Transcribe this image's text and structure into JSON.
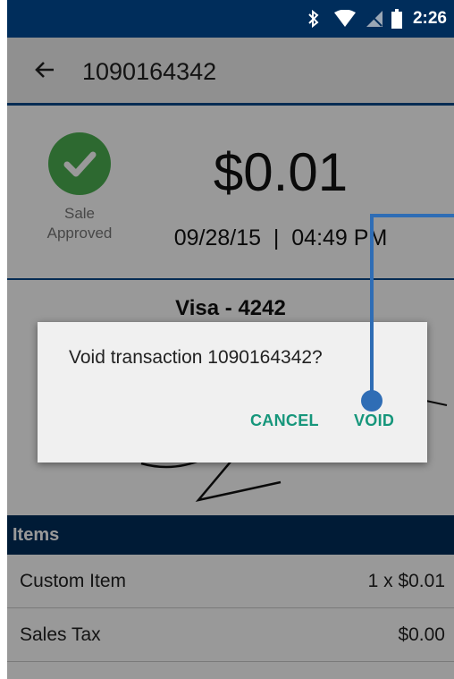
{
  "status_bar": {
    "time": "2:26",
    "icons": [
      "bluetooth-icon",
      "wifi-icon",
      "no-signal-icon",
      "battery-icon"
    ]
  },
  "app_bar": {
    "title": "1090164342",
    "back_icon": "arrow-left-icon"
  },
  "transaction": {
    "status_line1": "Sale",
    "status_line2": "Approved",
    "amount": "$0.01",
    "datetime": "09/28/15  |  04:49 PM",
    "card": "Visa - 4242"
  },
  "items": {
    "header": "Items",
    "rows": [
      {
        "name": "Custom Item",
        "value": "1 x $0.01"
      },
      {
        "name": "Sales Tax",
        "value": "$0.00"
      }
    ]
  },
  "dialog": {
    "message": "Void transaction 1090164342?",
    "cancel_label": "CANCEL",
    "void_label": "VOID"
  },
  "colors": {
    "primary_dark": "#002d5b",
    "accent_teal": "#16967b",
    "approved_green": "#4caf50",
    "annotation_blue": "#2f6db5"
  }
}
